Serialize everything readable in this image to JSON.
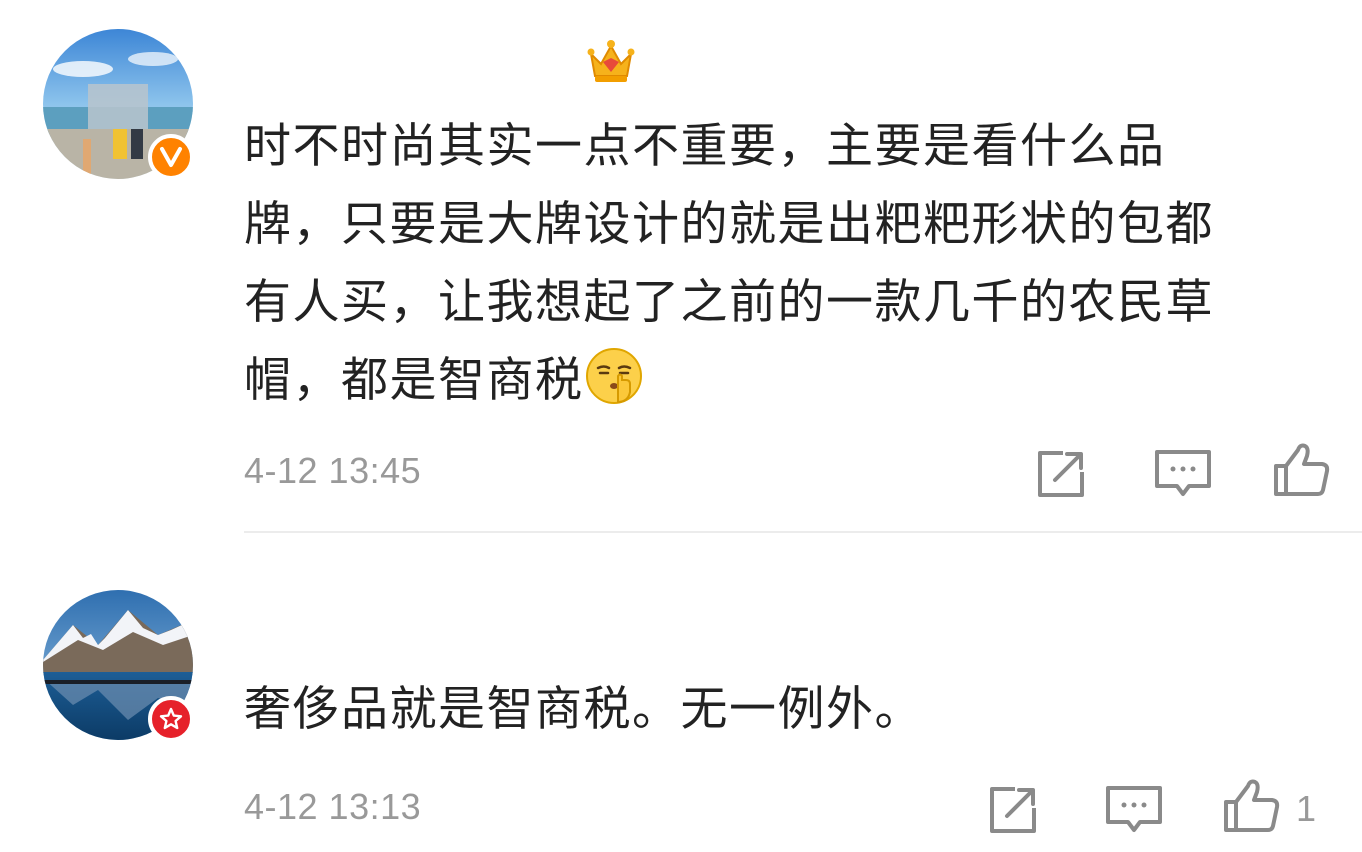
{
  "comments": [
    {
      "username": "",
      "text_lines": [
        "时不时尚其实一点不重要，主要是看什么品",
        "牌，只要是大牌设计的就是出粑粑形状的包都",
        "有人买，让我想起了之前的一款几千的农民草",
        "帽，都是智商税"
      ],
      "emoji": "shushing-face-emoji",
      "time": "4-12 13:45",
      "badge": "V",
      "like_count": ""
    },
    {
      "username": "",
      "text_lines": [
        "奢侈品就是智商税。无一例外。"
      ],
      "time": "4-12 13:13",
      "badge": "star",
      "like_count": "1"
    }
  ],
  "colors": {
    "text": "#222222",
    "meta": "#999999",
    "icon": "#8a8a8a",
    "badge_v": "#ff8200",
    "badge_star": "#e6212a",
    "divider": "#ececec"
  },
  "icons": [
    "share-icon",
    "comment-icon",
    "like-icon",
    "crown-icon"
  ]
}
